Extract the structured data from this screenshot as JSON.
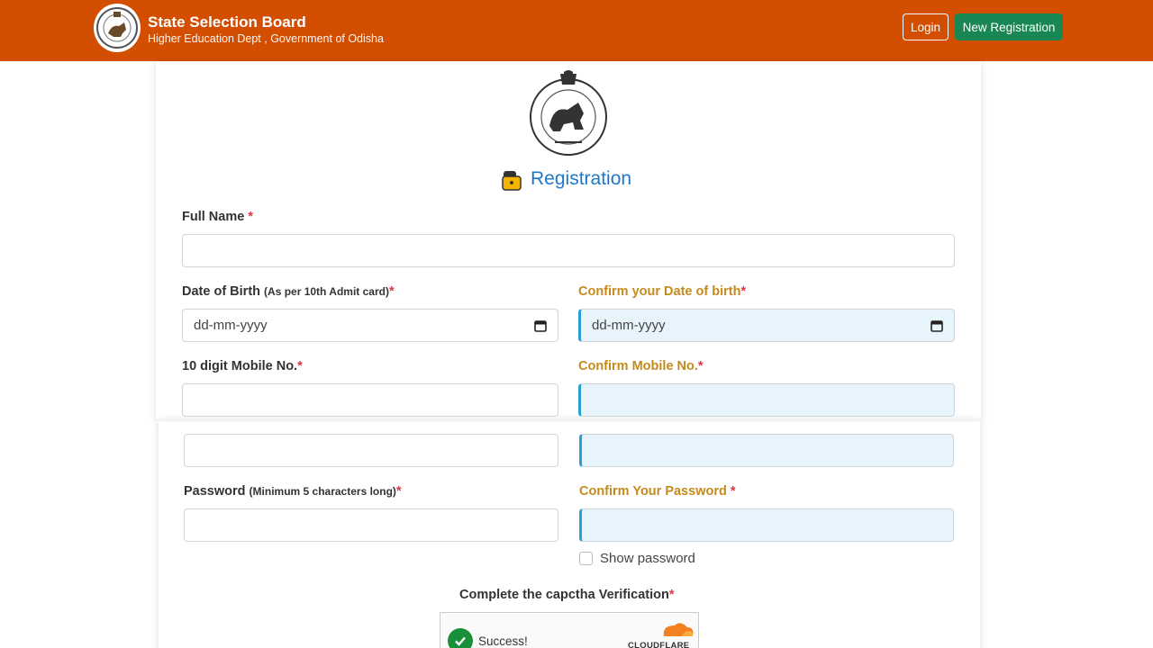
{
  "header": {
    "title": "State Selection Board",
    "subtitle": "Higher Education Dept , Government of Odisha",
    "login_label": "Login",
    "register_label": "New Registration"
  },
  "form": {
    "heading": "Registration",
    "required_mark": "*",
    "full_name": {
      "label": "Full Name"
    },
    "dob": {
      "label": "Date of Birth",
      "note": "(As per 10th Admit card)",
      "placeholder": "dd-mm-yyyy"
    },
    "confirm_dob": {
      "label": "Confirm your Date of birth",
      "placeholder": "dd-mm-yyyy"
    },
    "mobile": {
      "label": "10 digit Mobile No."
    },
    "confirm_mobile": {
      "label": "Confirm Mobile No."
    },
    "password": {
      "label": "Password",
      "note": "(Minimum 5 characters long)"
    },
    "confirm_password": {
      "label": "Confirm Your Password",
      "required_mark": " *"
    },
    "show_password": "Show password",
    "captcha_label": "Complete the capctha Verification",
    "captcha_status": "Success!",
    "captcha_brand": "CLOUDFLARE"
  },
  "colors": {
    "header_bg": "#d34e00",
    "register_btn": "#198754",
    "heading_blue": "#1e78c8",
    "confirm_label_gold": "#c48a1c",
    "required_red": "#dc3545"
  }
}
